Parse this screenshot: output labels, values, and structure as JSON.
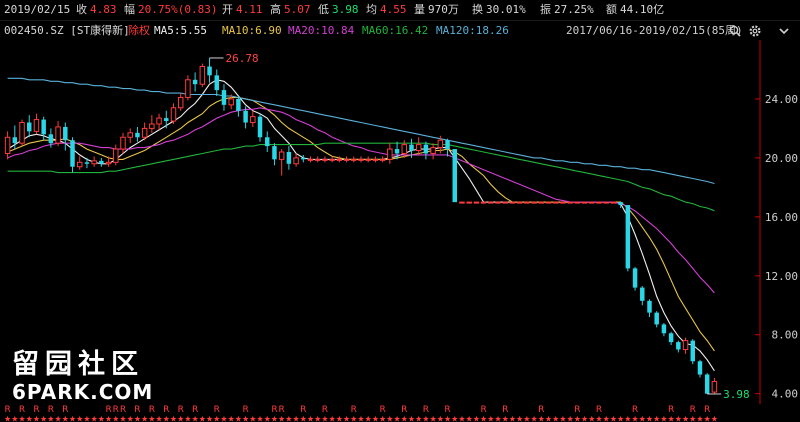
{
  "quote": {
    "date": "2019/02/15",
    "close_label": "收",
    "close": "4.83",
    "change_label": "幅",
    "change": "20.75%(0.83)",
    "open_label": "开",
    "open": "4.11",
    "high_label": "高",
    "high": "5.07",
    "low_label": "低",
    "low": "3.98",
    "avg_label": "均",
    "avg": "4.55",
    "volume_label": "量",
    "volume": "970万",
    "turnover_label": "换",
    "turnover": "30.01%",
    "amplitude_label": "振",
    "amplitude": "27.25%",
    "amount_label": "额",
    "amount": "44.10亿"
  },
  "indicator_bar": {
    "stock": "002450.SZ [ST康得新]",
    "weight_label": "除权",
    "ma5": "MA5:5.55",
    "ma10": "MA10:6.90",
    "ma20": "MA20:10.84",
    "ma60": "MA60:16.42",
    "ma120": "MA120:18.26",
    "period": "2017/06/16-2019/02/15(85周)"
  },
  "icons": [
    "search-icon",
    "gear-icon",
    "collapse-icon"
  ],
  "colors": {
    "up": "#ff3b3b",
    "down": "#2bd6e6",
    "ma5": "#f0f0f0",
    "ma10": "#e8c547",
    "ma20": "#d43fd4",
    "ma60": "#22b33a",
    "ma120": "#5ab0d8",
    "axis": "#cc0000"
  },
  "annotations": {
    "max_label": "26.78",
    "min_label": "3.98"
  },
  "watermark": {
    "cn": "留园社区",
    "en": "6PARK.COM"
  },
  "markers": {
    "r_label": "R"
  },
  "chart_data": {
    "type": "candlestick",
    "ylim": [
      3.3,
      28.0
    ],
    "y_ticks": [
      "24.00",
      "20.00",
      "16.00",
      "12.00",
      "8.00",
      "4.00"
    ],
    "y_tick_values": [
      24,
      20,
      16,
      12,
      8,
      4
    ],
    "candles": [
      [
        20.3,
        21.4,
        19.9,
        21.8
      ],
      [
        21.4,
        21.0,
        20.6,
        22.2
      ],
      [
        21.0,
        22.4,
        20.8,
        22.6
      ],
      [
        22.4,
        21.8,
        21.4,
        22.9
      ],
      [
        21.8,
        22.6,
        21.6,
        23.0
      ],
      [
        22.6,
        21.6,
        21.2,
        22.8
      ],
      [
        21.6,
        21.0,
        20.7,
        22.0
      ],
      [
        21.0,
        22.1,
        20.8,
        22.5
      ],
      [
        22.1,
        21.2,
        20.5,
        22.4
      ],
      [
        21.2,
        19.4,
        19.0,
        21.4
      ],
      [
        19.4,
        19.7,
        19.2,
        20.1
      ],
      [
        19.7,
        19.6,
        19.3,
        20.0
      ],
      [
        19.6,
        19.8,
        19.4,
        20.1
      ],
      [
        19.8,
        19.6,
        19.4,
        20.0
      ],
      [
        19.6,
        19.7,
        19.4,
        20.1
      ],
      [
        19.7,
        20.6,
        19.5,
        20.9
      ],
      [
        20.6,
        21.4,
        20.3,
        21.7
      ],
      [
        21.4,
        21.7,
        21.0,
        22.0
      ],
      [
        21.7,
        21.4,
        21.1,
        22.1
      ],
      [
        21.4,
        22.0,
        21.2,
        22.4
      ],
      [
        22.0,
        22.3,
        21.7,
        22.9
      ],
      [
        22.3,
        22.7,
        21.9,
        23.0
      ],
      [
        22.7,
        22.5,
        22.0,
        23.2
      ],
      [
        22.5,
        23.4,
        22.3,
        23.7
      ],
      [
        23.4,
        24.1,
        23.2,
        24.4
      ],
      [
        24.1,
        25.3,
        23.9,
        25.6
      ],
      [
        25.3,
        25.0,
        24.5,
        25.8
      ],
      [
        25.0,
        26.2,
        24.8,
        26.4
      ],
      [
        26.2,
        25.6,
        25.1,
        26.78
      ],
      [
        25.6,
        24.6,
        24.2,
        26.0
      ],
      [
        24.6,
        23.6,
        23.2,
        25.0
      ],
      [
        23.6,
        24.0,
        23.3,
        24.3
      ],
      [
        24.0,
        23.2,
        22.8,
        24.2
      ],
      [
        23.2,
        22.4,
        22.0,
        23.5
      ],
      [
        22.4,
        22.8,
        22.1,
        23.2
      ],
      [
        22.8,
        21.4,
        21.1,
        23.0
      ],
      [
        21.4,
        20.8,
        20.4,
        21.8
      ],
      [
        20.8,
        19.9,
        19.5,
        21.0
      ],
      [
        19.9,
        20.4,
        18.8,
        20.6
      ],
      [
        20.4,
        19.6,
        19.2,
        20.8
      ],
      [
        19.6,
        20.0,
        19.4,
        20.3
      ],
      [
        20.0,
        19.9,
        19.7,
        20.2
      ],
      [
        19.9,
        19.9,
        19.7,
        20.1
      ],
      [
        19.9,
        19.9,
        19.7,
        20.1
      ],
      [
        19.9,
        19.9,
        19.7,
        20.1
      ],
      [
        19.9,
        19.9,
        19.7,
        20.1
      ],
      [
        19.9,
        19.9,
        19.7,
        20.1
      ],
      [
        19.9,
        19.9,
        19.7,
        20.1
      ],
      [
        19.9,
        19.9,
        19.7,
        20.1
      ],
      [
        19.9,
        19.9,
        19.7,
        20.1
      ],
      [
        19.9,
        19.9,
        19.7,
        20.1
      ],
      [
        19.9,
        19.9,
        19.7,
        20.1
      ],
      [
        19.9,
        19.9,
        19.7,
        20.1
      ],
      [
        19.9,
        20.6,
        19.6,
        21.0
      ],
      [
        20.6,
        20.3,
        19.9,
        21.1
      ],
      [
        20.3,
        20.9,
        20.0,
        21.2
      ],
      [
        20.9,
        20.5,
        20.0,
        21.3
      ],
      [
        20.5,
        20.9,
        20.2,
        21.4
      ],
      [
        20.9,
        20.3,
        19.9,
        21.1
      ],
      [
        20.3,
        20.7,
        19.9,
        21.0
      ],
      [
        20.7,
        21.2,
        20.3,
        21.5
      ],
      [
        21.2,
        20.6,
        20.1,
        21.3
      ],
      [
        20.6,
        17.0,
        17.0,
        20.6
      ],
      [
        17.0,
        17.0,
        17.0,
        17.0
      ],
      [
        17.0,
        17.0,
        17.0,
        17.0
      ],
      [
        17.0,
        17.0,
        17.0,
        17.0
      ],
      [
        17.0,
        17.0,
        17.0,
        17.0
      ],
      [
        17.0,
        17.0,
        17.0,
        17.0
      ],
      [
        17.0,
        17.0,
        17.0,
        17.0
      ],
      [
        17.0,
        17.0,
        17.0,
        17.0
      ],
      [
        17.0,
        17.0,
        17.0,
        17.0
      ],
      [
        17.0,
        17.0,
        17.0,
        17.0
      ],
      [
        17.0,
        17.0,
        17.0,
        17.0
      ],
      [
        17.0,
        17.0,
        17.0,
        17.0
      ],
      [
        17.0,
        17.0,
        17.0,
        17.0
      ],
      [
        17.0,
        17.0,
        17.0,
        17.0
      ],
      [
        17.0,
        17.0,
        17.0,
        17.0
      ],
      [
        17.0,
        17.0,
        17.0,
        17.0
      ],
      [
        17.0,
        17.0,
        17.0,
        17.0
      ],
      [
        17.0,
        17.0,
        17.0,
        17.0
      ],
      [
        17.0,
        17.0,
        17.0,
        17.0
      ],
      [
        17.0,
        17.0,
        17.0,
        17.0
      ],
      [
        17.0,
        17.0,
        17.0,
        17.0
      ],
      [
        17.0,
        17.0,
        17.0,
        17.0
      ],
      [
        17.0,
        17.0,
        17.0,
        17.0
      ],
      [
        17.0,
        16.8,
        16.6,
        17.0
      ],
      [
        16.8,
        12.5,
        12.3,
        16.8
      ],
      [
        12.5,
        11.2,
        11.0,
        12.6
      ],
      [
        11.2,
        10.3,
        10.0,
        11.3
      ],
      [
        10.3,
        9.5,
        9.2,
        10.4
      ],
      [
        9.5,
        8.7,
        8.5,
        9.6
      ],
      [
        8.7,
        8.1,
        7.9,
        8.8
      ],
      [
        8.1,
        7.5,
        7.3,
        8.2
      ],
      [
        7.5,
        7.0,
        6.8,
        7.6
      ],
      [
        7.0,
        7.6,
        6.7,
        7.8
      ],
      [
        7.6,
        6.2,
        6.0,
        7.7
      ],
      [
        6.2,
        5.3,
        5.1,
        6.3
      ],
      [
        5.3,
        4.0,
        3.98,
        5.4
      ],
      [
        4.11,
        4.83,
        3.98,
        5.07
      ]
    ],
    "ma_series": [
      {
        "name": "MA5",
        "values": [
          20.6,
          20.9,
          21.2,
          21.5,
          21.6,
          21.5,
          21.3,
          21.2,
          21.0,
          20.6,
          20.2,
          19.9,
          19.7,
          19.6,
          19.6,
          19.9,
          20.3,
          20.7,
          21.0,
          21.3,
          21.6,
          21.9,
          22.2,
          22.5,
          22.8,
          23.3,
          23.7,
          24.3,
          25.0,
          25.3,
          25.2,
          24.8,
          24.2,
          23.6,
          23.2,
          23.0,
          22.7,
          22.0,
          21.5,
          21.0,
          20.3,
          20.0,
          19.9,
          19.9,
          19.9,
          19.9,
          19.9,
          19.9,
          19.9,
          19.9,
          19.9,
          19.9,
          19.9,
          20.0,
          20.1,
          20.3,
          20.5,
          20.6,
          20.6,
          20.6,
          20.7,
          20.7,
          20.0,
          19.3,
          18.6,
          17.8,
          17.0,
          17.0,
          17.0,
          17.0,
          17.0,
          17.0,
          17.0,
          17.0,
          17.0,
          17.0,
          17.0,
          17.0,
          17.0,
          17.0,
          17.0,
          17.0,
          17.0,
          17.0,
          17.0,
          16.9,
          16.0,
          14.8,
          13.5,
          12.1,
          10.6,
          9.5,
          8.6,
          7.9,
          7.4,
          7.3,
          6.9,
          6.3,
          5.55
        ]
      },
      {
        "name": "MA10",
        "values": [
          20.4,
          20.6,
          20.8,
          21.0,
          21.1,
          21.2,
          21.2,
          21.2,
          21.3,
          21.1,
          20.9,
          20.6,
          20.4,
          20.2,
          20.0,
          19.9,
          19.9,
          20.1,
          20.3,
          20.5,
          20.8,
          21.1,
          21.4,
          21.7,
          22.0,
          22.4,
          22.7,
          23.0,
          23.5,
          23.8,
          24.0,
          24.1,
          24.1,
          24.0,
          23.9,
          23.6,
          23.3,
          22.9,
          22.4,
          22.0,
          21.7,
          21.4,
          21.1,
          20.7,
          20.4,
          20.1,
          20.0,
          19.9,
          19.9,
          19.9,
          19.9,
          19.9,
          19.9,
          19.9,
          20.0,
          20.1,
          20.2,
          20.3,
          20.4,
          20.5,
          20.5,
          20.6,
          20.4,
          20.1,
          19.6,
          19.2,
          18.8,
          18.2,
          17.7,
          17.3,
          17.0,
          17.0,
          17.0,
          17.0,
          17.0,
          17.0,
          17.0,
          17.0,
          17.0,
          17.0,
          17.0,
          17.0,
          17.0,
          17.0,
          17.0,
          17.0,
          16.6,
          16.0,
          15.3,
          14.6,
          13.8,
          12.8,
          11.7,
          10.6,
          9.8,
          9.0,
          8.2,
          7.6,
          6.9
        ]
      },
      {
        "name": "MA20",
        "values": [
          20.0,
          20.2,
          20.3,
          20.5,
          20.6,
          20.8,
          20.9,
          21.0,
          21.0,
          21.0,
          21.0,
          20.9,
          20.8,
          20.7,
          20.7,
          20.6,
          20.6,
          20.6,
          20.7,
          20.7,
          20.8,
          20.9,
          21.1,
          21.2,
          21.4,
          21.6,
          21.9,
          22.1,
          22.4,
          22.7,
          22.9,
          23.1,
          23.2,
          23.3,
          23.3,
          23.4,
          23.3,
          23.2,
          23.1,
          22.9,
          22.6,
          22.4,
          22.2,
          21.9,
          21.7,
          21.4,
          21.2,
          21.0,
          20.8,
          20.7,
          20.5,
          20.4,
          20.3,
          20.2,
          20.2,
          20.2,
          20.2,
          20.2,
          20.2,
          20.2,
          20.2,
          20.2,
          20.0,
          19.8,
          19.6,
          19.4,
          19.2,
          19.0,
          18.8,
          18.6,
          18.4,
          18.2,
          18.0,
          17.8,
          17.6,
          17.4,
          17.2,
          17.1,
          17.0,
          17.0,
          17.0,
          17.0,
          17.0,
          17.0,
          17.0,
          16.9,
          16.7,
          16.4,
          16.0,
          15.6,
          15.2,
          14.7,
          14.2,
          13.6,
          13.1,
          12.5,
          11.9,
          11.4,
          10.84
        ]
      },
      {
        "name": "MA60",
        "values": [
          19.1,
          19.1,
          19.1,
          19.1,
          19.1,
          19.1,
          19.1,
          19.0,
          19.0,
          19.0,
          19.0,
          19.0,
          19.0,
          19.0,
          19.1,
          19.1,
          19.2,
          19.3,
          19.4,
          19.5,
          19.6,
          19.7,
          19.8,
          19.9,
          20.0,
          20.1,
          20.2,
          20.3,
          20.4,
          20.5,
          20.6,
          20.6,
          20.7,
          20.8,
          20.8,
          20.9,
          20.9,
          20.9,
          20.9,
          20.9,
          20.9,
          20.9,
          20.9,
          20.9,
          21.0,
          21.0,
          21.0,
          21.0,
          21.0,
          21.0,
          21.0,
          21.0,
          21.0,
          21.0,
          21.0,
          21.0,
          21.0,
          21.0,
          21.0,
          20.9,
          20.9,
          20.9,
          20.8,
          20.7,
          20.6,
          20.5,
          20.4,
          20.3,
          20.2,
          20.1,
          20.0,
          19.9,
          19.8,
          19.7,
          19.6,
          19.5,
          19.4,
          19.3,
          19.2,
          19.1,
          19.0,
          18.9,
          18.8,
          18.7,
          18.6,
          18.5,
          18.4,
          18.2,
          18.0,
          17.9,
          17.7,
          17.5,
          17.4,
          17.2,
          17.0,
          16.9,
          16.7,
          16.6,
          16.42
        ]
      },
      {
        "name": "MA120",
        "values": [
          25.4,
          25.4,
          25.4,
          25.3,
          25.3,
          25.3,
          25.2,
          25.2,
          25.1,
          25.1,
          25.0,
          25.0,
          24.9,
          24.9,
          24.8,
          24.8,
          24.7,
          24.7,
          24.6,
          24.6,
          24.5,
          24.5,
          24.4,
          24.4,
          24.4,
          24.3,
          24.3,
          24.3,
          24.3,
          24.3,
          24.2,
          24.2,
          24.1,
          24.0,
          23.9,
          23.8,
          23.7,
          23.6,
          23.5,
          23.4,
          23.3,
          23.2,
          23.1,
          23.0,
          22.9,
          22.8,
          22.7,
          22.6,
          22.5,
          22.4,
          22.3,
          22.2,
          22.1,
          22.0,
          21.9,
          21.8,
          21.7,
          21.6,
          21.5,
          21.4,
          21.3,
          21.2,
          21.1,
          21.0,
          20.9,
          20.8,
          20.7,
          20.6,
          20.5,
          20.4,
          20.3,
          20.2,
          20.1,
          20.0,
          20.0,
          19.9,
          19.8,
          19.8,
          19.7,
          19.7,
          19.6,
          19.6,
          19.5,
          19.5,
          19.4,
          19.4,
          19.3,
          19.3,
          19.2,
          19.2,
          19.1,
          19.0,
          18.9,
          18.8,
          18.7,
          18.6,
          18.5,
          18.4,
          18.26
        ]
      }
    ]
  }
}
